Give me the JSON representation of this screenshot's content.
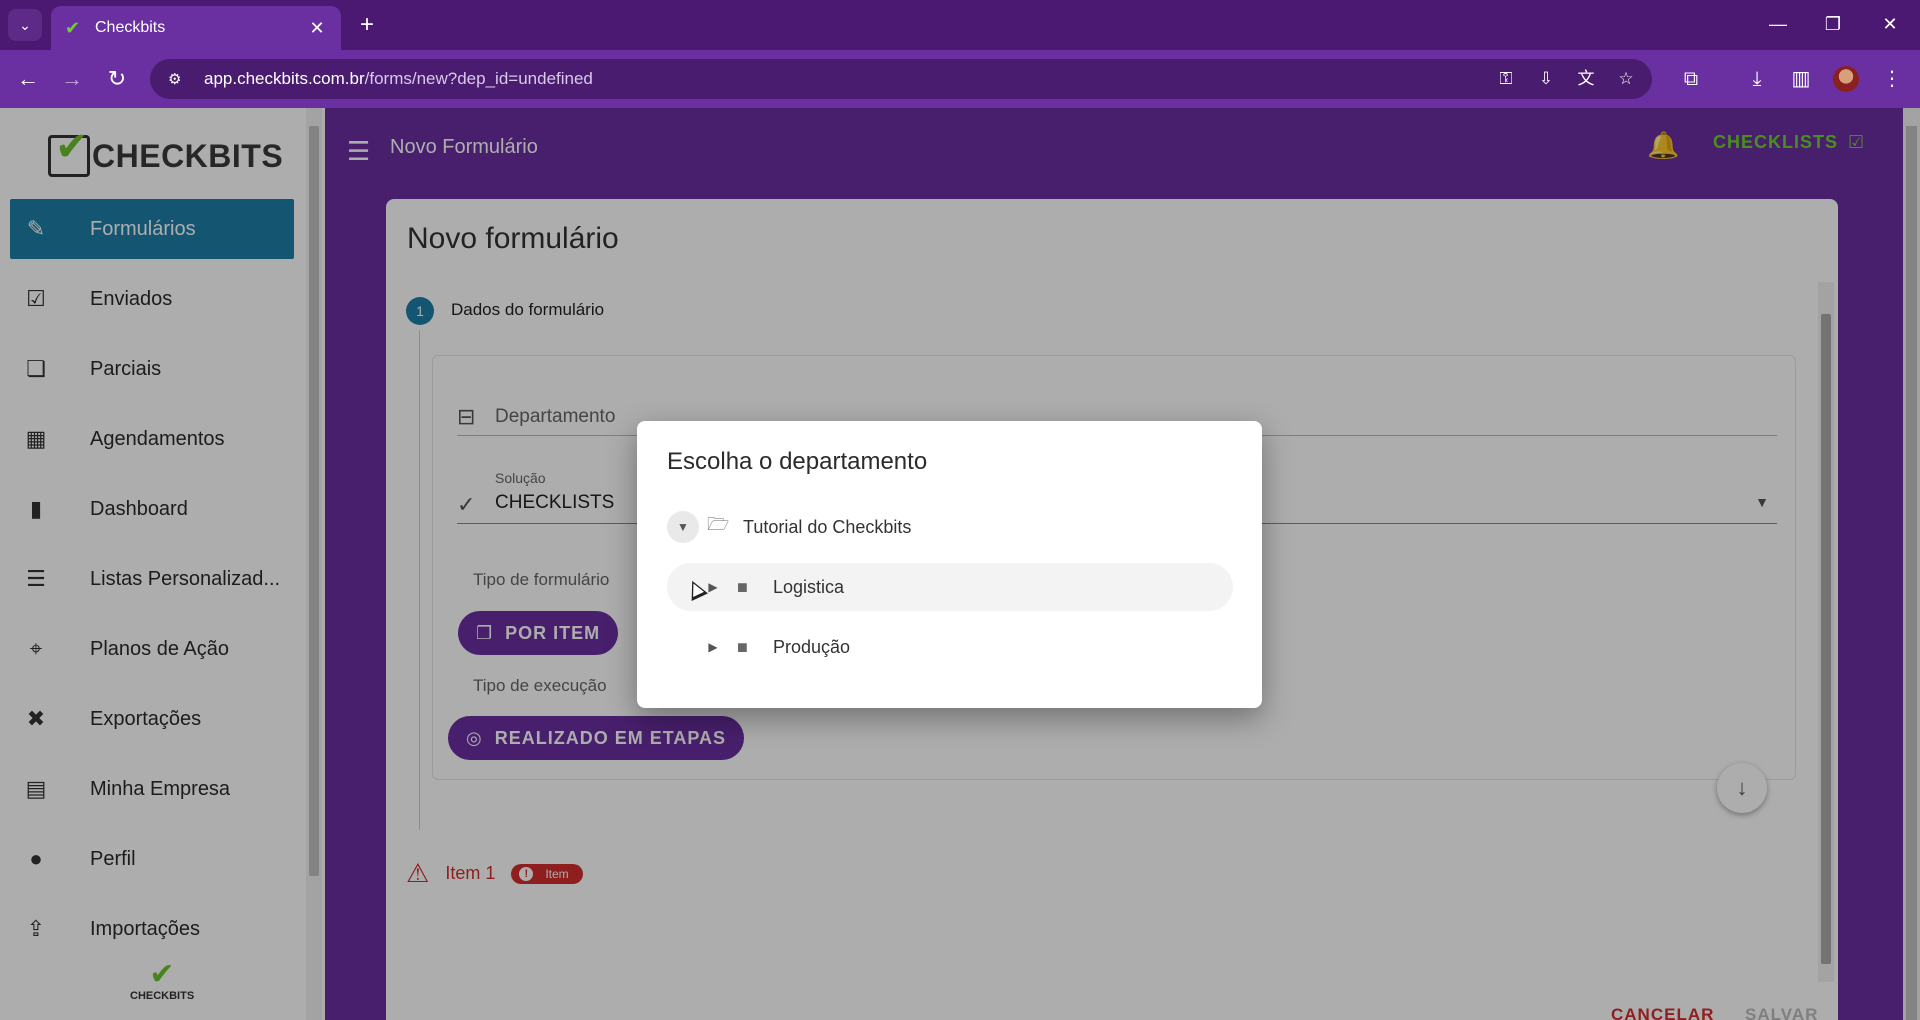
{
  "browser": {
    "tab_title": "Checkbits",
    "url_host": "app.checkbits.com.br",
    "url_path": "/forms/new?dep_id=undefined"
  },
  "sidebar": {
    "logo_text": "CHECKBITS",
    "mini_logo_text": "CHECKBITS",
    "items": [
      {
        "label": "Formulários",
        "icon": "form-icon"
      },
      {
        "label": "Enviados",
        "icon": "sent-icon"
      },
      {
        "label": "Parciais",
        "icon": "partial-icon"
      },
      {
        "label": "Agendamentos",
        "icon": "calendar-icon"
      },
      {
        "label": "Dashboard",
        "icon": "chart-icon"
      },
      {
        "label": "Listas Personalizad...",
        "icon": "database-icon"
      },
      {
        "label": "Planos de Ação",
        "icon": "target-icon"
      },
      {
        "label": "Exportações",
        "icon": "excel-icon"
      },
      {
        "label": "Minha Empresa",
        "icon": "building-icon"
      },
      {
        "label": "Perfil",
        "icon": "person-icon"
      },
      {
        "label": "Importações",
        "icon": "import-icon"
      }
    ]
  },
  "header": {
    "title": "Novo Formulário",
    "checklists_label": "CHECKLISTS"
  },
  "form": {
    "title": "Novo formulário",
    "step_number": "1",
    "step_label": "Dados do formulário",
    "department_label": "Departamento",
    "solution_label": "Solução",
    "solution_value": "CHECKLISTS",
    "form_type_label": "Tipo de formulário",
    "form_type_button": "POR ITEM",
    "execution_type_label": "Tipo de execução",
    "execution_type_button": "REALIZADO EM ETAPAS",
    "item_name": "Item 1",
    "item_badge": "Item",
    "cancel_label": "CANCELAR",
    "save_label": "SALVAR"
  },
  "dialog": {
    "title": "Escolha o departamento",
    "root": "Tutorial do Checkbits",
    "children": [
      "Logistica",
      "Produção"
    ]
  },
  "colors": {
    "brand_purple": "#6a2fa0",
    "active_blue": "#1e7fa8",
    "accent_green": "#6cd12f",
    "error_red": "#d32f2f"
  }
}
